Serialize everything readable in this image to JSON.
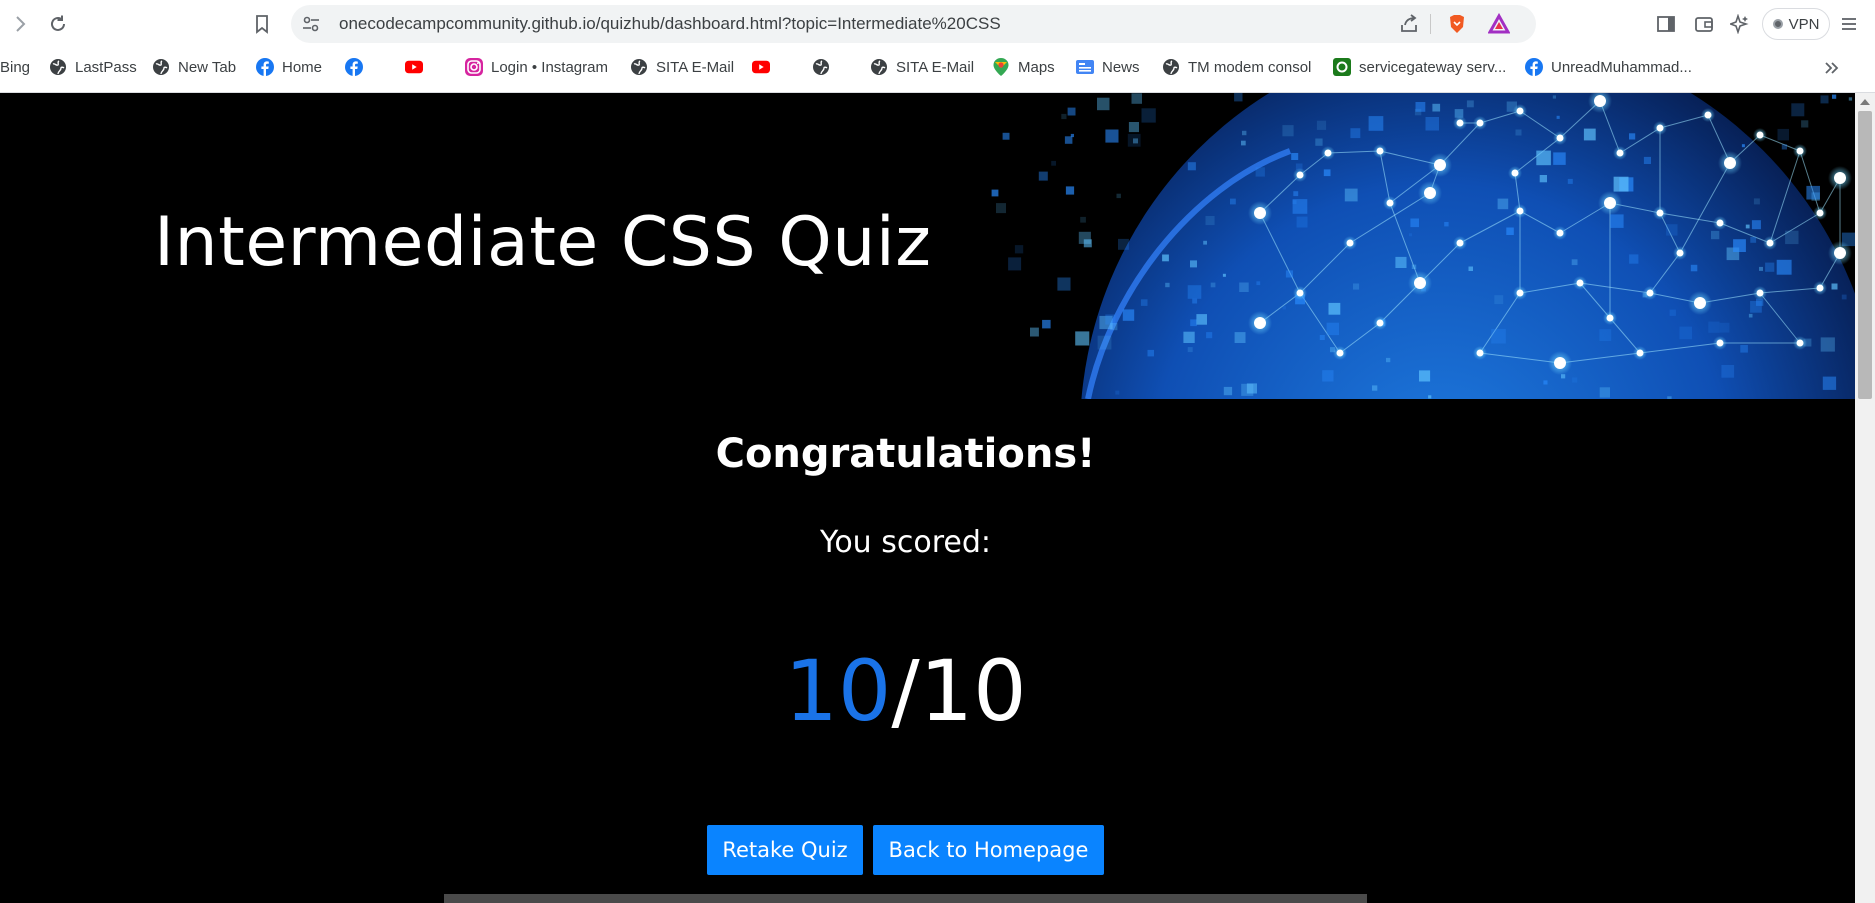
{
  "browser": {
    "url": "onecodecampcommunity.github.io/quizhub/dashboard.html?topic=Intermediate%20CSS",
    "vpn_label": "VPN",
    "bookmarks": [
      {
        "label": "Bing",
        "icon": "none"
      },
      {
        "label": "LastPass",
        "icon": "globe-icon"
      },
      {
        "label": "New Tab",
        "icon": "globe-icon"
      },
      {
        "label": "Home",
        "icon": "facebook-icon"
      },
      {
        "label": "",
        "icon": "facebook-icon"
      },
      {
        "label": "",
        "icon": "youtube-icon"
      },
      {
        "label": "Login • Instagram",
        "icon": "instagram-icon"
      },
      {
        "label": "SITA E-Mail",
        "icon": "globe-icon"
      },
      {
        "label": "",
        "icon": "youtube-icon"
      },
      {
        "label": "",
        "icon": "globe-icon"
      },
      {
        "label": "SITA E-Mail",
        "icon": "globe-icon"
      },
      {
        "label": "Maps",
        "icon": "maps-icon"
      },
      {
        "label": "News",
        "icon": "news-icon"
      },
      {
        "label": "TM modem consol",
        "icon": "globe-icon"
      },
      {
        "label": "servicegateway serv...",
        "icon": "router-icon"
      },
      {
        "label": "UnreadMuhammad...",
        "icon": "facebook-icon"
      }
    ]
  },
  "page": {
    "title": "Intermediate CSS Quiz",
    "congrats": "Congratulations!",
    "you_scored": "You scored:",
    "score": {
      "correct": "10",
      "separator": "/",
      "total": "10"
    },
    "buttons": {
      "retake": "Retake Quiz",
      "home": "Back to Homepage"
    }
  },
  "colors": {
    "accent": "#0a84ff",
    "score_highlight": "#1a73e8",
    "background": "#000000",
    "text": "#ffffff"
  }
}
